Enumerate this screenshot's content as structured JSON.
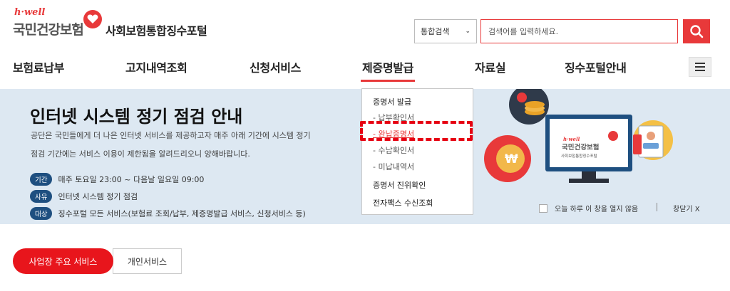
{
  "header": {
    "logo_small": "h·well",
    "logo_name": "국민건강보험",
    "portal_title": "사회보험통합징수포털"
  },
  "search": {
    "select_value": "통합검색",
    "placeholder": "검색어를 입력하세요."
  },
  "nav": {
    "items": [
      "보험료납부",
      "고지내역조회",
      "신청서비스",
      "제증명발급",
      "자료실",
      "징수포털안내"
    ],
    "active": "제증명발급"
  },
  "banner": {
    "title": "인터넷 시스템 정기 점검 안내",
    "desc1": "공단은 국민들에게 더 나은 인터넷 서비스를 제공하고자 매주 아래 기간에 시스템 정기",
    "desc2": "점검 기간에는 서비스 이용이 제한됨을 알려드리오니 양해바랍니다.",
    "rows": [
      {
        "tag": "기간",
        "text": "매주 토요일 23:00 ~ 다음날 일요일 09:00"
      },
      {
        "tag": "사유",
        "text": "인터넷 시스템 정기 점검"
      },
      {
        "tag": "대상",
        "text": "징수포털 모든 서비스(보험료 조회/납부, 제증명발급 서비스, 신청서비스 등)"
      }
    ],
    "no_show_today": "오늘 하루 이 창을 열지 않음",
    "close_label": "창닫기 X",
    "illus_logo_small": "h·well",
    "illus_logo_name": "국민건강보험",
    "illus_logo_sub": "사회보험통합징수포털"
  },
  "dropdown": {
    "items": [
      {
        "label": "증명서 발급",
        "type": "head"
      },
      {
        "label": "- 납부확인서",
        "type": "sub"
      },
      {
        "label": "- 완납증명서",
        "type": "sub-highlight"
      },
      {
        "label": "- 수납확인서",
        "type": "sub"
      },
      {
        "label": "- 미납내역서",
        "type": "sub"
      },
      {
        "label": "증명서 진위확인",
        "type": "head"
      },
      {
        "label": "전자팩스 수신조회",
        "type": "head"
      }
    ]
  },
  "tabs": {
    "primary": "사업장 주요 서비스",
    "secondary": "개인서비스"
  },
  "colors": {
    "brand_red": "#e8393a",
    "banner_bg": "#dde8f2",
    "tag_blue": "#1e4f80",
    "highlight_red": "#e60012"
  }
}
